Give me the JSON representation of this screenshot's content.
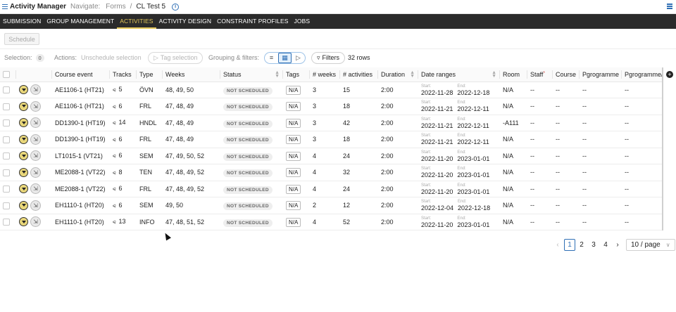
{
  "header": {
    "app_title": "Activity Manager",
    "navigate_label": "Navigate:",
    "breadcrumb_parent": "Forms",
    "breadcrumb_sep": "/",
    "breadcrumb_current": "CL Test 5",
    "info_icon_glyph": "i"
  },
  "tabs": [
    "SUBMISSION",
    "GROUP MANAGEMENT",
    "ACTIVITIES",
    "ACTIVITY DESIGN",
    "CONSTRAINT PROFILES",
    "JOBS"
  ],
  "active_tab": "ACTIVITIES",
  "accent_color": "#e5c75a",
  "toolbar": {
    "schedule_label": "Schedule"
  },
  "filterbar": {
    "selection_label": "Selection:",
    "selection_count": "0",
    "actions_label": "Actions:",
    "unschedule_label": "Unschedule selection",
    "tag_selection_label": "Tag selection",
    "grouping_label": "Grouping & filters:",
    "filters_label": "Filters",
    "rows_label": "32 rows"
  },
  "columns": [
    "Course event",
    "Tracks",
    "Type",
    "Weeks",
    "Status",
    "Tags",
    "# weeks",
    "# activities",
    "Duration",
    "Date ranges",
    "Room",
    "Staff",
    "Course",
    "Pgrogramme",
    "Pgrogramme/g"
  ],
  "staff_required_mark": "*",
  "start_label": "Start:",
  "end_label": "End:",
  "rows": [
    {
      "course_event": "AE1106-1 (HT21)",
      "tracks": "5",
      "type": "ÖVN",
      "weeks": "48, 49, 50",
      "status": "NOT SCHEDULED",
      "tags": "N/A",
      "num_weeks": "3",
      "num_activities": "15",
      "duration": "2:00",
      "start": "2022-11-28",
      "end": "2022-12-18",
      "room": "N/A",
      "staff": "--",
      "course": "--",
      "programme": "--",
      "programme_g": "--"
    },
    {
      "course_event": "AE1106-1 (HT21)",
      "tracks": "6",
      "type": "FRL",
      "weeks": "47, 48, 49",
      "status": "NOT SCHEDULED",
      "tags": "N/A",
      "num_weeks": "3",
      "num_activities": "18",
      "duration": "2:00",
      "start": "2022-11-21",
      "end": "2022-12-11",
      "room": "N/A",
      "staff": "--",
      "course": "--",
      "programme": "--",
      "programme_g": "--"
    },
    {
      "course_event": "DD1390-1 (HT19)",
      "tracks": "14",
      "type": "HNDL",
      "weeks": "47, 48, 49",
      "status": "NOT SCHEDULED",
      "tags": "N/A",
      "num_weeks": "3",
      "num_activities": "42",
      "duration": "2:00",
      "start": "2022-11-21",
      "end": "2022-12-11",
      "room": "-A111",
      "staff": "--",
      "course": "--",
      "programme": "--",
      "programme_g": "--"
    },
    {
      "course_event": "DD1390-1 (HT19)",
      "tracks": "6",
      "type": "FRL",
      "weeks": "47, 48, 49",
      "status": "NOT SCHEDULED",
      "tags": "N/A",
      "num_weeks": "3",
      "num_activities": "18",
      "duration": "2:00",
      "start": "2022-11-21",
      "end": "2022-12-11",
      "room": "N/A",
      "staff": "--",
      "course": "--",
      "programme": "--",
      "programme_g": "--"
    },
    {
      "course_event": "LT1015-1 (VT21)",
      "tracks": "6",
      "type": "SEM",
      "weeks": "47, 49, 50, 52",
      "status": "NOT SCHEDULED",
      "tags": "N/A",
      "num_weeks": "4",
      "num_activities": "24",
      "duration": "2:00",
      "start": "2022-11-20",
      "end": "2023-01-01",
      "room": "N/A",
      "staff": "--",
      "course": "--",
      "programme": "--",
      "programme_g": "--"
    },
    {
      "course_event": "ME2088-1 (VT22)",
      "tracks": "8",
      "type": "TEN",
      "weeks": "47, 48, 49, 52",
      "status": "NOT SCHEDULED",
      "tags": "N/A",
      "num_weeks": "4",
      "num_activities": "32",
      "duration": "2:00",
      "start": "2022-11-20",
      "end": "2023-01-01",
      "room": "N/A",
      "staff": "--",
      "course": "--",
      "programme": "--",
      "programme_g": "--"
    },
    {
      "course_event": "ME2088-1 (VT22)",
      "tracks": "6",
      "type": "FRL",
      "weeks": "47, 48, 49, 52",
      "status": "NOT SCHEDULED",
      "tags": "N/A",
      "num_weeks": "4",
      "num_activities": "24",
      "duration": "2:00",
      "start": "2022-11-20",
      "end": "2023-01-01",
      "room": "N/A",
      "staff": "--",
      "course": "--",
      "programme": "--",
      "programme_g": "--"
    },
    {
      "course_event": "EH1110-1 (HT20)",
      "tracks": "6",
      "type": "SEM",
      "weeks": "49, 50",
      "status": "NOT SCHEDULED",
      "tags": "N/A",
      "num_weeks": "2",
      "num_activities": "12",
      "duration": "2:00",
      "start": "2022-12-04",
      "end": "2022-12-18",
      "room": "N/A",
      "staff": "--",
      "course": "--",
      "programme": "--",
      "programme_g": "--"
    },
    {
      "course_event": "EH1110-1 (HT20)",
      "tracks": "13",
      "type": "INFO",
      "weeks": "47, 48, 51, 52",
      "status": "NOT SCHEDULED",
      "tags": "N/A",
      "num_weeks": "4",
      "num_activities": "52",
      "duration": "2:00",
      "start": "2022-11-20",
      "end": "2023-01-01",
      "room": "N/A",
      "staff": "--",
      "course": "--",
      "programme": "--",
      "programme_g": "--"
    }
  ],
  "pagination": {
    "prev": "‹",
    "pages": [
      "1",
      "2",
      "3",
      "4"
    ],
    "current": "1",
    "next": "›",
    "page_size": "10 / page"
  }
}
